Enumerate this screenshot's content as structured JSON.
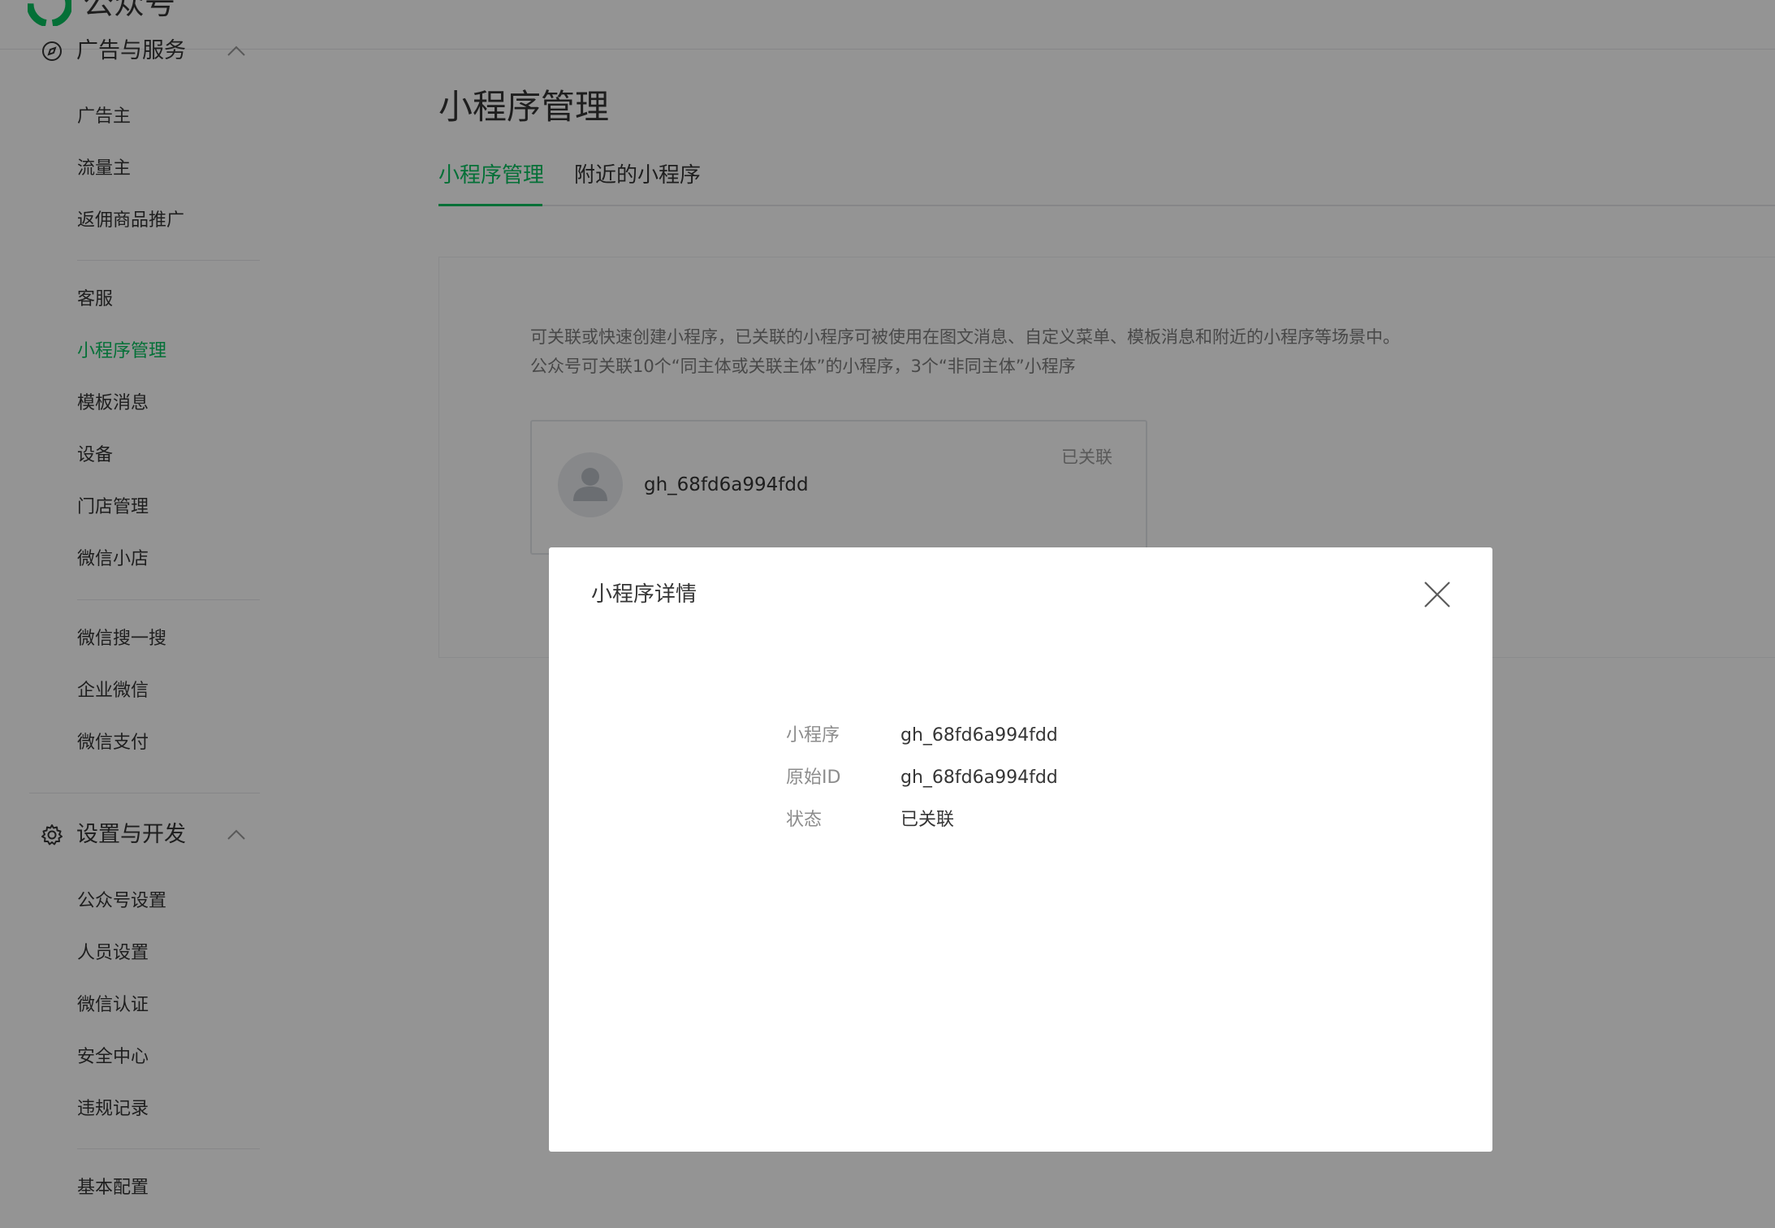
{
  "header": {
    "brand": "公众号"
  },
  "sidebar": {
    "groups": [
      {
        "title": "广告与服务",
        "icon": "compass-icon",
        "items": [
          "广告主",
          "流量主",
          "返佣商品推广"
        ]
      },
      {
        "items": [
          "客服",
          "小程序管理",
          "模板消息",
          "设备",
          "门店管理",
          "微信小店"
        ]
      },
      {
        "items": [
          "微信搜一搜",
          "企业微信",
          "微信支付"
        ]
      },
      {
        "title": "设置与开发",
        "icon": "gear-icon",
        "items": [
          "公众号设置",
          "人员设置",
          "微信认证",
          "安全中心",
          "违规记录"
        ]
      },
      {
        "items": [
          "基本配置"
        ]
      }
    ],
    "active_item": "小程序管理"
  },
  "main": {
    "title": "小程序管理",
    "tabs": [
      {
        "label": "小程序管理",
        "active": true
      },
      {
        "label": "附近的小程序",
        "active": false
      }
    ],
    "description": [
      "可关联或快速创建小程序，已关联的小程序可被使用在图文消息、自定义菜单、模板消息和附近的小程序等场景中。",
      "公众号可关联10个“同主体或关联主体”的小程序，3个“非同主体”小程序"
    ],
    "card": {
      "name": "gh_68fd6a994fdd",
      "status": "已关联"
    }
  },
  "dialog": {
    "title": "小程序详情",
    "rows": [
      {
        "label": "小程序",
        "value": "gh_68fd6a994fdd"
      },
      {
        "label": "原始ID",
        "value": "gh_68fd6a994fdd"
      },
      {
        "label": "状态",
        "value": "已关联"
      }
    ]
  },
  "colors": {
    "accent": "#07c160",
    "text": "#353535",
    "muted": "#8c8c8c",
    "mask": "rgba(0,0,0,0.42)"
  }
}
